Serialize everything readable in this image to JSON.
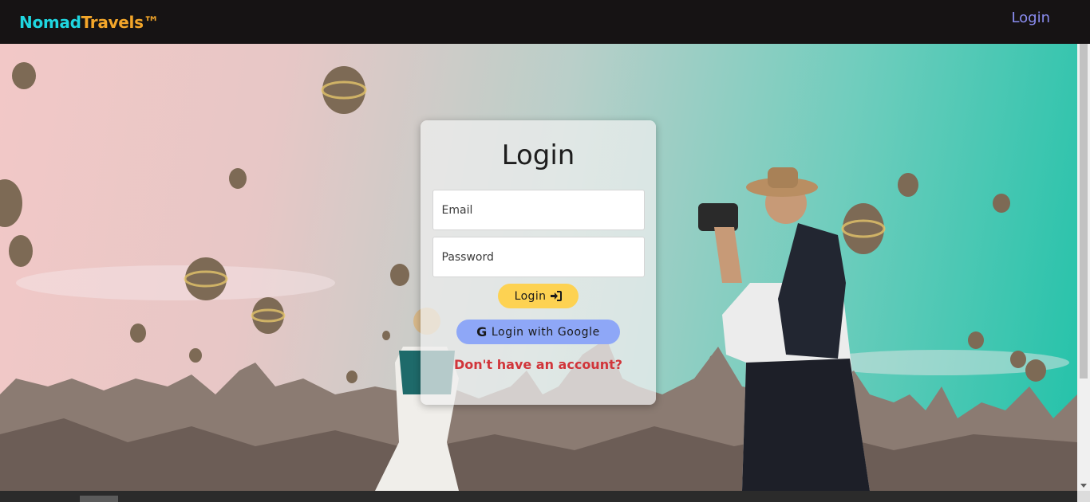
{
  "navbar": {
    "brand_part1": "Nomad",
    "brand_part2": "Travels™",
    "login_link": "Login"
  },
  "login_card": {
    "title": "Login",
    "email_placeholder": "Email",
    "password_placeholder": "Password",
    "login_button": "Login",
    "google_button": "Login with Google",
    "signup_link": "Don't have an account?"
  },
  "icons": {
    "login_button_icon": "sign-in-icon",
    "google_button_icon": "google-icon"
  },
  "colors": {
    "brand_cyan": "#1fd6e0",
    "brand_orange": "#f3a62a",
    "nav_link": "#8a8cf0",
    "login_button": "#fdd252",
    "google_button": "#8ea7f7",
    "signup_link": "#d1353a"
  }
}
